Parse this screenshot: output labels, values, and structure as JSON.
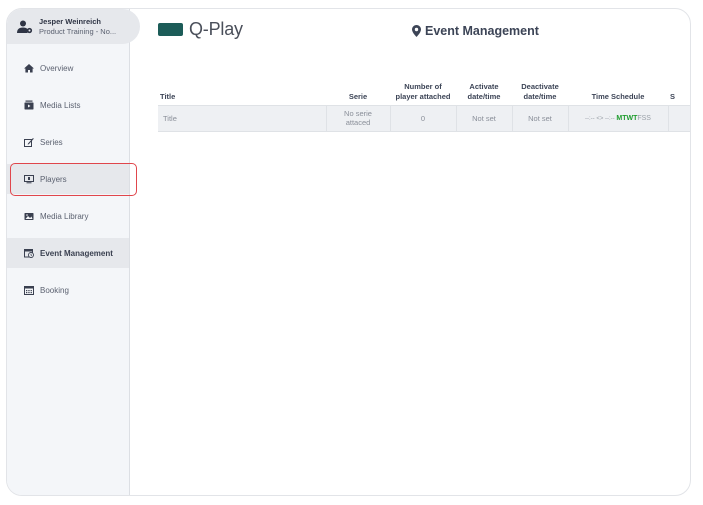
{
  "user": {
    "name": "Jesper Weinreich",
    "organization": "Product Training - No..."
  },
  "sidebar": {
    "items": [
      {
        "label": "Overview",
        "icon": "home-icon"
      },
      {
        "label": "Media Lists",
        "icon": "media-list-icon"
      },
      {
        "label": "Series",
        "icon": "edit-square-icon"
      },
      {
        "label": "Players",
        "icon": "player-screen-icon",
        "highlighted": true
      },
      {
        "label": "Media Library",
        "icon": "image-library-icon"
      },
      {
        "label": "Event Management",
        "icon": "calendar-clock-icon",
        "active": true
      },
      {
        "label": "Booking",
        "icon": "calendar-icon"
      }
    ]
  },
  "header": {
    "brand": "Q-Play",
    "page_title": "Event Management"
  },
  "colors": {
    "brand": "#1c5c58",
    "highlight_border": "#e0464c",
    "schedule_active_day": "#1f9c2e"
  },
  "table": {
    "columns": [
      "Title",
      "Serie",
      "Number of player attached",
      "Activate date/time",
      "Deactivate date/time",
      "Time Schedule",
      "S"
    ],
    "column_lines": [
      [
        "Title"
      ],
      [
        "Serie"
      ],
      [
        "Number of",
        "player attached"
      ],
      [
        "Activate",
        "date/time"
      ],
      [
        "Deactivate",
        "date/time"
      ],
      [
        "Time Schedule"
      ],
      [
        "S"
      ]
    ],
    "rows": [
      {
        "title": "Title",
        "serie_line1": "No serie",
        "serie_line2": "attaced",
        "players": "0",
        "activate": "Not set",
        "deactivate": "Not set",
        "schedule_time": "--:-- <> --:--",
        "schedule_days_active": "MTWT",
        "schedule_days_inactive": "FSS"
      }
    ]
  }
}
